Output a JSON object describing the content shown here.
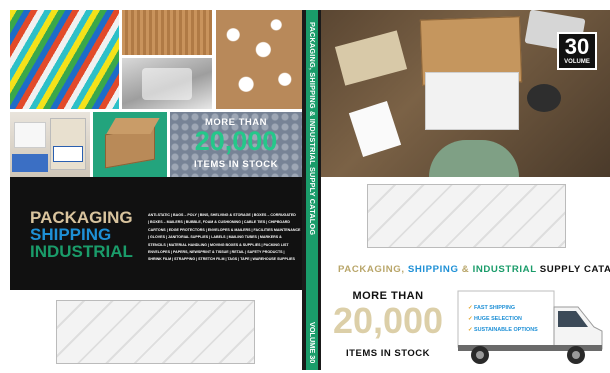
{
  "back_cover": {
    "callout": {
      "more_than": "MORE THAN",
      "count": "20,000",
      "items": "ITEMS IN STOCK"
    },
    "brand_lines": [
      "PACKAGING",
      "SHIPPING",
      "INDUSTRIAL"
    ],
    "categories_lines": [
      "ANTI-STATIC | BAGS – POLY | BINS, SHELVING & STORAGE | BOXES – CORRUGATED",
      "| BOXES – MAILERS | BUBBLE, FOAM & CUSHIONING | CABLE TIES | CHIPBOARD",
      "CARTONS | EDGE PROTECTORS | ENVELOPES & MAILERS | FACILITIES MAINTENANCE",
      "| GLOVES | JANITORIAL SUPPLIES | LABELS | MAILING TUBES | MARKERS &",
      "STENCILS | MATERIAL HANDLING | MOVING BOXES & SUPPLIES | PACKING LIST",
      "ENVELOPES | PAPERS, NEWSPRINT & TISSUE | RETAIL | SAFETY PRODUCTS |",
      "SHRINK FILM | STRAPPING | STRETCH FILM | TAGS | TAPE | WAREHOUSE SUPPLIES"
    ]
  },
  "spine": {
    "title": "PACKAGING, SHIPPING & INDUSTRIAL SUPPLY CATALOG",
    "volume": "VOLUME 30"
  },
  "front_cover": {
    "badge": {
      "number": "30",
      "label": "VOLUME"
    },
    "headline": {
      "part1": "PACKAGING, ",
      "part2": "SHIPPING",
      "part3": " & ",
      "part4": "INDUSTRIAL",
      "part5": " SUPPLY CATALOG"
    },
    "callout": {
      "more_than": "MORE THAN",
      "count": "20,000",
      "items": "ITEMS IN STOCK"
    },
    "truck_features": [
      "FAST SHIPPING",
      "HUGE SELECTION",
      "SUSTAINABLE OPTIONS"
    ]
  },
  "colors": {
    "green": "#1a9c6a",
    "blue": "#1e90d6",
    "tan": "#d9c49e",
    "olive": "#b9a66a",
    "black": "#111111"
  }
}
